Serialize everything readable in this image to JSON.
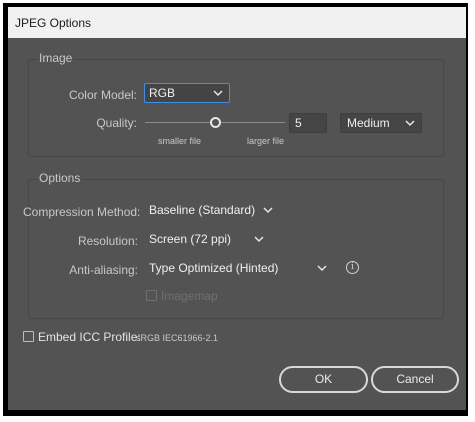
{
  "window": {
    "title": "JPEG Options"
  },
  "image_group": {
    "title": "Image",
    "color_model_label": "Color Model:",
    "color_model_value": "RGB",
    "quality_label": "Quality:",
    "quality_value": "5",
    "quality_level": 0.5,
    "quality_preset": "Medium",
    "smaller_label": "smaller file",
    "larger_label": "larger file"
  },
  "options_group": {
    "title": "Options",
    "compression_label": "Compression Method:",
    "compression_value": "Baseline (Standard)",
    "resolution_label": "Resolution:",
    "resolution_value": "Screen (72 ppi)",
    "antialiasing_label": "Anti-aliasing:",
    "antialiasing_value": "Type Optimized (Hinted)",
    "imagemap_label": "Imagemap"
  },
  "embed": {
    "label": "Embed ICC Profile:",
    "profile": "sRGB IEC61966-2.1"
  },
  "buttons": {
    "ok": "OK",
    "cancel": "Cancel"
  },
  "colors": {
    "focus": "#3f8fe6",
    "panel": "#535353"
  },
  "icons": {
    "dropdown": "chevron-down-icon",
    "info": "info-icon"
  }
}
